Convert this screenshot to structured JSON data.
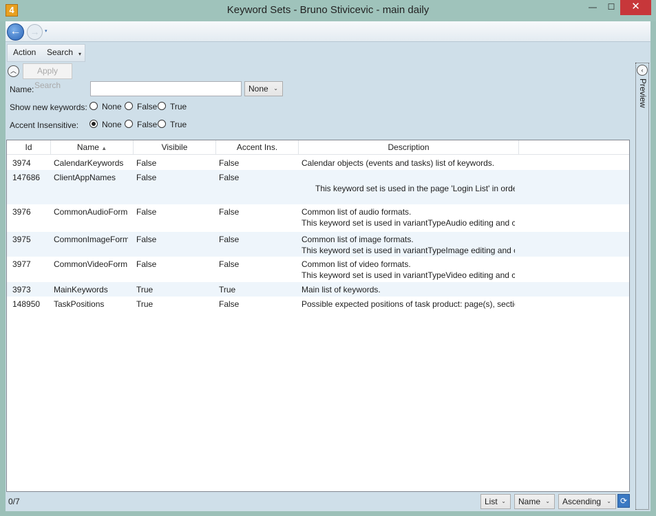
{
  "window": {
    "app_icon_text": "4",
    "title": "Keyword Sets - Bruno Stivicevic - main daily",
    "minimize_glyph": "—",
    "maximize_glyph": "☐",
    "close_glyph": "✕"
  },
  "nav": {
    "back_icon": "←",
    "forward_icon": "→",
    "dropdown_icon": "▾"
  },
  "menu": {
    "action": "Action",
    "search": "Search",
    "overflow_icon": "▾"
  },
  "search_panel": {
    "collapse_icon": "︿",
    "apply_label": "Apply Search",
    "name_label": "Name:",
    "name_value": "",
    "name_combo": "None",
    "show_new_label": "Show new keywords:",
    "accent_label": "Accent Insensitive:",
    "opt_none": "None",
    "opt_false": "False",
    "opt_true": "True",
    "show_new_selected": "",
    "accent_selected": "None"
  },
  "grid": {
    "columns": [
      "Id",
      "Name",
      "Visibile",
      "Accent Ins.",
      "Description"
    ],
    "sort_icon": "▲",
    "rows": [
      {
        "id": "3974",
        "name": "CalendarKeywords",
        "visible": "False",
        "accent": "False",
        "desc1": "Calendar objects (events and tasks) list of keywords.",
        "desc2": ""
      },
      {
        "id": "147686",
        "name": "ClientAppNames",
        "visible": "False",
        "accent": "False",
        "desc1": "",
        "desc2": "This keyword set is used in the page 'Login List' in orde"
      },
      {
        "id": "3976",
        "name": "CommonAudioForm",
        "visible": "False",
        "accent": "False",
        "desc1": "Common list of audio formats.",
        "desc2": "This keyword set is used in variantTypeAudio editing and c"
      },
      {
        "id": "3975",
        "name": "CommonImageForm",
        "visible": "False",
        "accent": "False",
        "desc1": "Common list of image formats.",
        "desc2": "This keyword set is used in variantTypeImage editing and c"
      },
      {
        "id": "3977",
        "name": "CommonVideoForm",
        "visible": "False",
        "accent": "False",
        "desc1": "Common list of video formats.",
        "desc2": "This keyword set is used in variantTypeVideo editing and c"
      },
      {
        "id": "3973",
        "name": "MainKeywords",
        "visible": "True",
        "accent": "True",
        "desc1": "Main list of keywords.",
        "desc2": ""
      },
      {
        "id": "148950",
        "name": "TaskPositions",
        "visible": "True",
        "accent": "False",
        "desc1": "Possible expected positions of task product: page(s), sectio",
        "desc2": ""
      }
    ]
  },
  "preview": {
    "label": "Preview",
    "toggle_icon": "‹"
  },
  "status": {
    "count": "0/7",
    "view": "List",
    "sort_field": "Name",
    "sort_order": "Ascending",
    "refresh_icon": "⟳"
  }
}
